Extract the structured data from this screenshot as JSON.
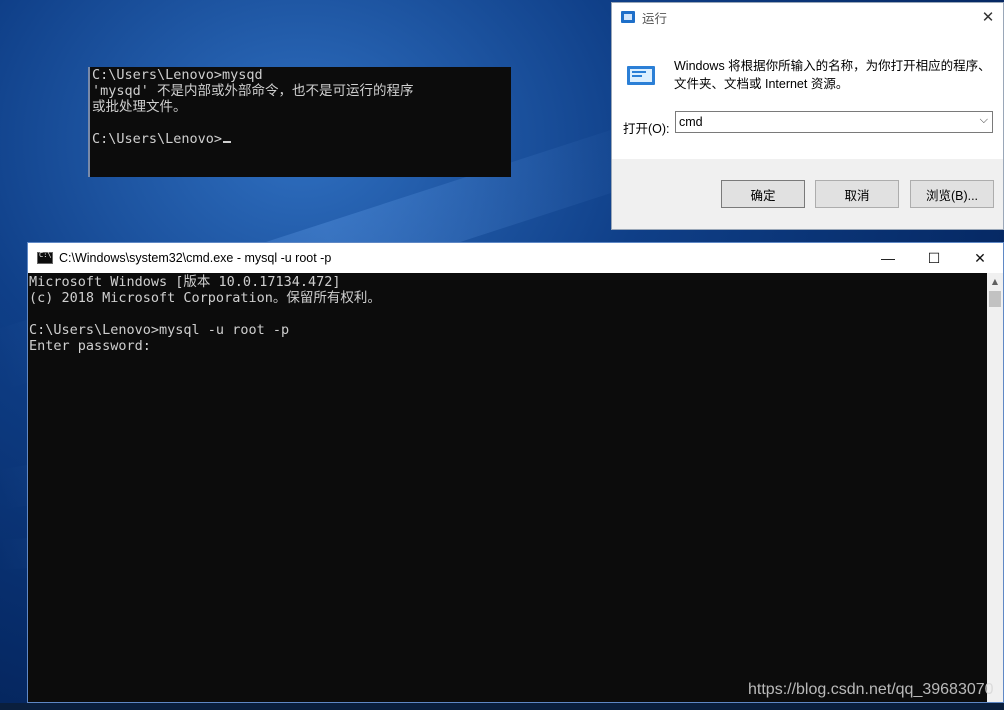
{
  "background_console": {
    "lines": [
      "C:\\Users\\Lenovo>mysqd",
      "'mysqd' 不是内部或外部命令，也不是可运行的程序",
      "或批处理文件。",
      "",
      "C:\\Users\\Lenovo>"
    ]
  },
  "run_dialog": {
    "title": "运行",
    "description_line1": "Windows 将根据你所输入的名称，为你打开相应的程序、",
    "description_line2": "文件夹、文档或 Internet 资源。",
    "open_label": "打开(O):",
    "input_value": "cmd",
    "ok_label": "确定",
    "cancel_label": "取消",
    "browse_label": "浏览(B)..."
  },
  "cmd_window": {
    "title": "C:\\Windows\\system32\\cmd.exe - mysql  -u root -p",
    "lines": [
      "Microsoft Windows [版本 10.0.17134.472]",
      "(c) 2018 Microsoft Corporation。保留所有权利。",
      "",
      "C:\\Users\\Lenovo>mysql -u root -p",
      "Enter password:"
    ]
  },
  "watermark": "https://blog.csdn.net/qq_39683070",
  "colors": {
    "console_bg": "#0c0c0c",
    "console_text": "#cfcfcf",
    "desktop_blue": "#0f3f88",
    "window_border": "#5f88c5"
  },
  "icons": [
    "run-app-icon",
    "close-icon",
    "run-large-icon",
    "chevron-down-icon",
    "cmd-app-icon",
    "minimize-icon",
    "maximize-icon",
    "scroll-up-arrow-icon"
  ]
}
